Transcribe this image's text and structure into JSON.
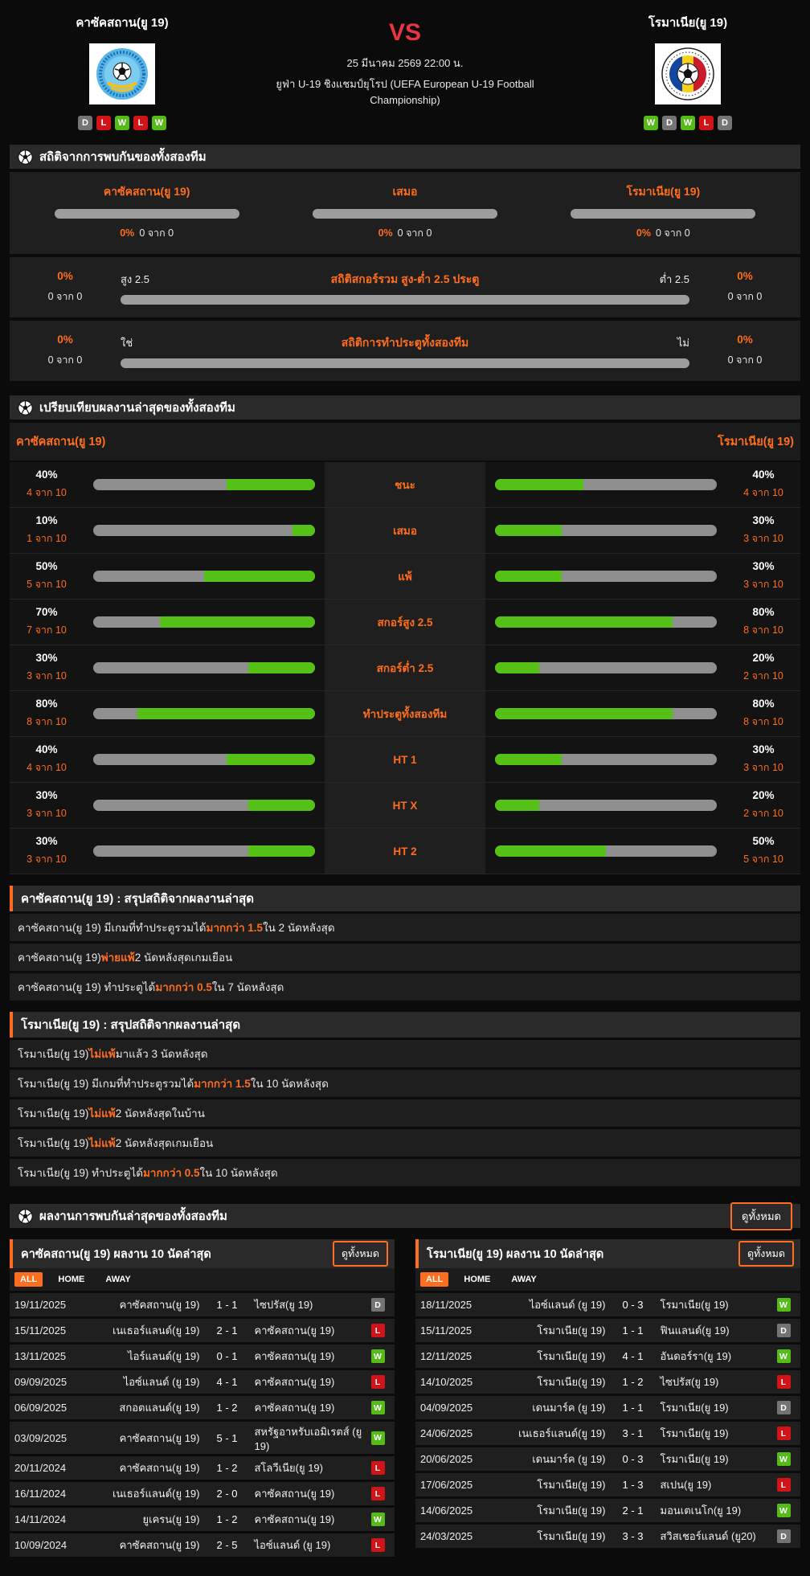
{
  "header": {
    "home": {
      "name": "คาซัคสถาน(ยู 19)",
      "form": [
        "D",
        "L",
        "W",
        "L",
        "W"
      ]
    },
    "away": {
      "name": "โรมาเนีย(ยู 19)",
      "form": [
        "W",
        "D",
        "W",
        "L",
        "D"
      ]
    },
    "vs": "VS",
    "datetime": "25 มีนาคม 2569 22:00 น.",
    "competition": "ยูฟ่า U-19 ชิงแชมป์ยุโรป (UEFA European U-19 Football Championship)"
  },
  "h2h": {
    "title": "สถิติจากการพบกันของทั้งสองทีม",
    "columns": [
      {
        "label": "คาซัคสถาน(ยู 19)",
        "pct": "0%",
        "count": "0 จาก 0"
      },
      {
        "label": "เสมอ",
        "pct": "0%",
        "count": "0 จาก 0"
      },
      {
        "label": "โรมาเนีย(ยู 19)",
        "pct": "0%",
        "count": "0 จาก 0"
      }
    ],
    "over_under": {
      "title": "สถิติสกอร์รวม สูง-ต่ำ 2.5 ประตู",
      "left_label": "สูง 2.5",
      "right_label": "ต่ำ 2.5",
      "left_pct": "0%",
      "left_count": "0 จาก 0",
      "right_pct": "0%",
      "right_count": "0 จาก 0"
    },
    "btts": {
      "title": "สถิติการทำประตูทั้งสองทีม",
      "left_label": "ใช่",
      "right_label": "ไม่",
      "left_pct": "0%",
      "left_count": "0 จาก 0",
      "right_pct": "0%",
      "right_count": "0 จาก 0"
    }
  },
  "comparison": {
    "title": "เปรียบเทียบผลงานล่าสุดของทั้งสองทีม",
    "home_name": "คาซัคสถาน(ยู 19)",
    "away_name": "โรมาเนีย(ยู 19)",
    "rows": [
      {
        "label": "ชนะ",
        "home_pct": 40,
        "home_count": "4 จาก 10",
        "away_pct": 40,
        "away_count": "4 จาก 10"
      },
      {
        "label": "เสมอ",
        "home_pct": 10,
        "home_count": "1 จาก 10",
        "away_pct": 30,
        "away_count": "3 จาก 10"
      },
      {
        "label": "แพ้",
        "home_pct": 50,
        "home_count": "5 จาก 10",
        "away_pct": 30,
        "away_count": "3 จาก 10"
      },
      {
        "label": "สกอร์สูง 2.5",
        "home_pct": 70,
        "home_count": "7 จาก 10",
        "away_pct": 80,
        "away_count": "8 จาก 10"
      },
      {
        "label": "สกอร์ต่ำ 2.5",
        "home_pct": 30,
        "home_count": "3 จาก 10",
        "away_pct": 20,
        "away_count": "2 จาก 10"
      },
      {
        "label": "ทำประตูทั้งสองทีม",
        "home_pct": 80,
        "home_count": "8 จาก 10",
        "away_pct": 80,
        "away_count": "8 จาก 10"
      },
      {
        "label": "HT 1",
        "home_pct": 40,
        "home_count": "4 จาก 10",
        "away_pct": 30,
        "away_count": "3 จาก 10"
      },
      {
        "label": "HT X",
        "home_pct": 30,
        "home_count": "3 จาก 10",
        "away_pct": 20,
        "away_count": "2 จาก 10"
      },
      {
        "label": "HT 2",
        "home_pct": 30,
        "home_count": "3 จาก 10",
        "away_pct": 50,
        "away_count": "5 จาก 10"
      }
    ]
  },
  "summaries": [
    {
      "title": "คาซัคสถาน(ยู 19) : สรุปสถิติจากผลงานล่าสุด",
      "rows": [
        [
          {
            "t": "คาซัคสถาน(ยู 19) มีเกมที่ทำประตูรวมได้ "
          },
          {
            "t": "มากกว่า 1.5",
            "hl": true
          },
          {
            "t": " ใน 2 นัดหลังสุด"
          }
        ],
        [
          {
            "t": "คาซัคสถาน(ยู 19) "
          },
          {
            "t": "พ่ายแพ้",
            "hl": true
          },
          {
            "t": " 2 นัดหลังสุดเกมเยือน"
          }
        ],
        [
          {
            "t": "คาซัคสถาน(ยู 19) ทำประตูได้ "
          },
          {
            "t": "มากกว่า 0.5",
            "hl": true
          },
          {
            "t": " ใน 7 นัดหลังสุด"
          }
        ]
      ]
    },
    {
      "title": "โรมาเนีย(ยู 19) : สรุปสถิติจากผลงานล่าสุด",
      "rows": [
        [
          {
            "t": "โรมาเนีย(ยู 19) "
          },
          {
            "t": "ไม่แพ้",
            "hl": true
          },
          {
            "t": " มาแล้ว 3 นัดหลังสุด"
          }
        ],
        [
          {
            "t": "โรมาเนีย(ยู 19) มีเกมที่ทำประตูรวมได้ "
          },
          {
            "t": "มากกว่า 1.5",
            "hl": true
          },
          {
            "t": " ใน 10 นัดหลังสุด"
          }
        ],
        [
          {
            "t": "โรมาเนีย(ยู 19) "
          },
          {
            "t": "ไม่แพ้",
            "hl": true
          },
          {
            "t": " 2 นัดหลังสุดในบ้าน"
          }
        ],
        [
          {
            "t": "โรมาเนีย(ยู 19) "
          },
          {
            "t": "ไม่แพ้",
            "hl": true
          },
          {
            "t": " 2 นัดหลังสุดเกมเยือน"
          }
        ],
        [
          {
            "t": "โรมาเนีย(ยู 19) ทำประตูได้ "
          },
          {
            "t": "มากกว่า 0.5",
            "hl": true
          },
          {
            "t": " ใน 10 นัดหลังสุด"
          }
        ]
      ]
    }
  ],
  "recent_meetings": {
    "title": "ผลงานการพบกันล่าสุดของทั้งสองทีม",
    "view_all": "ดูทั้งหมด"
  },
  "tables": [
    {
      "title": "คาซัคสถาน(ยู 19) ผลงาน 10 นัดล่าสุด",
      "view_all": "ดูทั้งหมด",
      "tabs": [
        "ALL",
        "HOME",
        "AWAY"
      ],
      "active_tab": "ALL",
      "rows": [
        {
          "date": "19/11/2025",
          "home": "คาซัคสถาน(ยู 19)",
          "score": "1 - 1",
          "away": "ไซปรัส(ยู 19)",
          "result": "D"
        },
        {
          "date": "15/11/2025",
          "home": "เนเธอร์แลนด์(ยู 19)",
          "score": "2 - 1",
          "away": "คาซัคสถาน(ยู 19)",
          "result": "L"
        },
        {
          "date": "13/11/2025",
          "home": "ไอร์แลนด์(ยู 19)",
          "score": "0 - 1",
          "away": "คาซัคสถาน(ยู 19)",
          "result": "W"
        },
        {
          "date": "09/09/2025",
          "home": "ไอซ์แลนด์ (ยู 19)",
          "score": "4 - 1",
          "away": "คาซัคสถาน(ยู 19)",
          "result": "L"
        },
        {
          "date": "06/09/2025",
          "home": "สกอตแลนด์(ยู 19)",
          "score": "1 - 2",
          "away": "คาซัคสถาน(ยู 19)",
          "result": "W"
        },
        {
          "date": "03/09/2025",
          "home": "คาซัคสถาน(ยู 19)",
          "score": "5 - 1",
          "away": "สหรัฐอาหรับเอมิเรตส์ (ยู 19)",
          "result": "W"
        },
        {
          "date": "20/11/2024",
          "home": "คาซัคสถาน(ยู 19)",
          "score": "1 - 2",
          "away": "สโลวีเนีย(ยู 19)",
          "result": "L"
        },
        {
          "date": "16/11/2024",
          "home": "เนเธอร์แลนด์(ยู 19)",
          "score": "2 - 0",
          "away": "คาซัคสถาน(ยู 19)",
          "result": "L"
        },
        {
          "date": "14/11/2024",
          "home": "ยูเครน(ยู 19)",
          "score": "1 - 2",
          "away": "คาซัคสถาน(ยู 19)",
          "result": "W"
        },
        {
          "date": "10/09/2024",
          "home": "คาซัคสถาน(ยู 19)",
          "score": "2 - 5",
          "away": "ไอซ์แลนด์ (ยู 19)",
          "result": "L"
        }
      ]
    },
    {
      "title": "โรมาเนีย(ยู 19) ผลงาน 10 นัดล่าสุด",
      "view_all": "ดูทั้งหมด",
      "tabs": [
        "ALL",
        "HOME",
        "AWAY"
      ],
      "active_tab": "ALL",
      "rows": [
        {
          "date": "18/11/2025",
          "home": "ไอซ์แลนด์ (ยู 19)",
          "score": "0 - 3",
          "away": "โรมาเนีย(ยู 19)",
          "result": "W"
        },
        {
          "date": "15/11/2025",
          "home": "โรมาเนีย(ยู 19)",
          "score": "1 - 1",
          "away": "ฟินแลนด์(ยู 19)",
          "result": "D"
        },
        {
          "date": "12/11/2025",
          "home": "โรมาเนีย(ยู 19)",
          "score": "4 - 1",
          "away": "อันดอร์รา(ยู 19)",
          "result": "W"
        },
        {
          "date": "14/10/2025",
          "home": "โรมาเนีย(ยู 19)",
          "score": "1 - 2",
          "away": "ไซปรัส(ยู 19)",
          "result": "L"
        },
        {
          "date": "04/09/2025",
          "home": "เดนมาร์ค (ยู 19)",
          "score": "1 - 1",
          "away": "โรมาเนีย(ยู 19)",
          "result": "D"
        },
        {
          "date": "24/06/2025",
          "home": "เนเธอร์แลนด์(ยู 19)",
          "score": "3 - 1",
          "away": "โรมาเนีย(ยู 19)",
          "result": "L"
        },
        {
          "date": "20/06/2025",
          "home": "เดนมาร์ค (ยู 19)",
          "score": "0 - 3",
          "away": "โรมาเนีย(ยู 19)",
          "result": "W"
        },
        {
          "date": "17/06/2025",
          "home": "โรมาเนีย(ยู 19)",
          "score": "1 - 3",
          "away": "สเปน(ยู 19)",
          "result": "L"
        },
        {
          "date": "14/06/2025",
          "home": "โรมาเนีย(ยู 19)",
          "score": "2 - 1",
          "away": "มอนเตเนโก(ยู 19)",
          "result": "W"
        },
        {
          "date": "24/03/2025",
          "home": "โรมาเนีย(ยู 19)",
          "score": "3 - 3",
          "away": "สวิสเชอร์แลนด์ (ยู20)",
          "result": "D"
        }
      ]
    }
  ],
  "colors": {
    "accent_orange": "#ff6e1f",
    "win_green": "#55bb17",
    "lose_red": "#d01418",
    "draw_gray": "#747474",
    "bar_gray": "#9d9d9d",
    "vs_red": "#e93540",
    "background": "#0b0b0b",
    "panel": "#1f1f1f"
  }
}
